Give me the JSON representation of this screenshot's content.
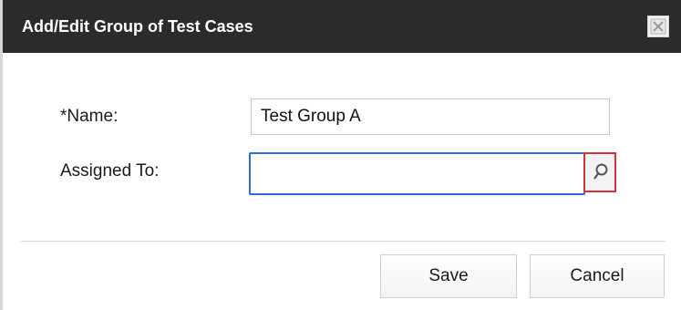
{
  "dialog": {
    "title": "Add/Edit Group of Test Cases",
    "close_icon": "close-icon"
  },
  "form": {
    "name_label": "*Name:",
    "name_value": "Test Group A",
    "assigned_label": "Assigned To:",
    "assigned_value": "",
    "lookup_icon": "search-icon"
  },
  "buttons": {
    "save_label": "Save",
    "cancel_label": "Cancel"
  },
  "colors": {
    "titlebar": "#2b2b2b",
    "focus_border": "#2f6bd8",
    "highlight_border": "#d3343a"
  }
}
